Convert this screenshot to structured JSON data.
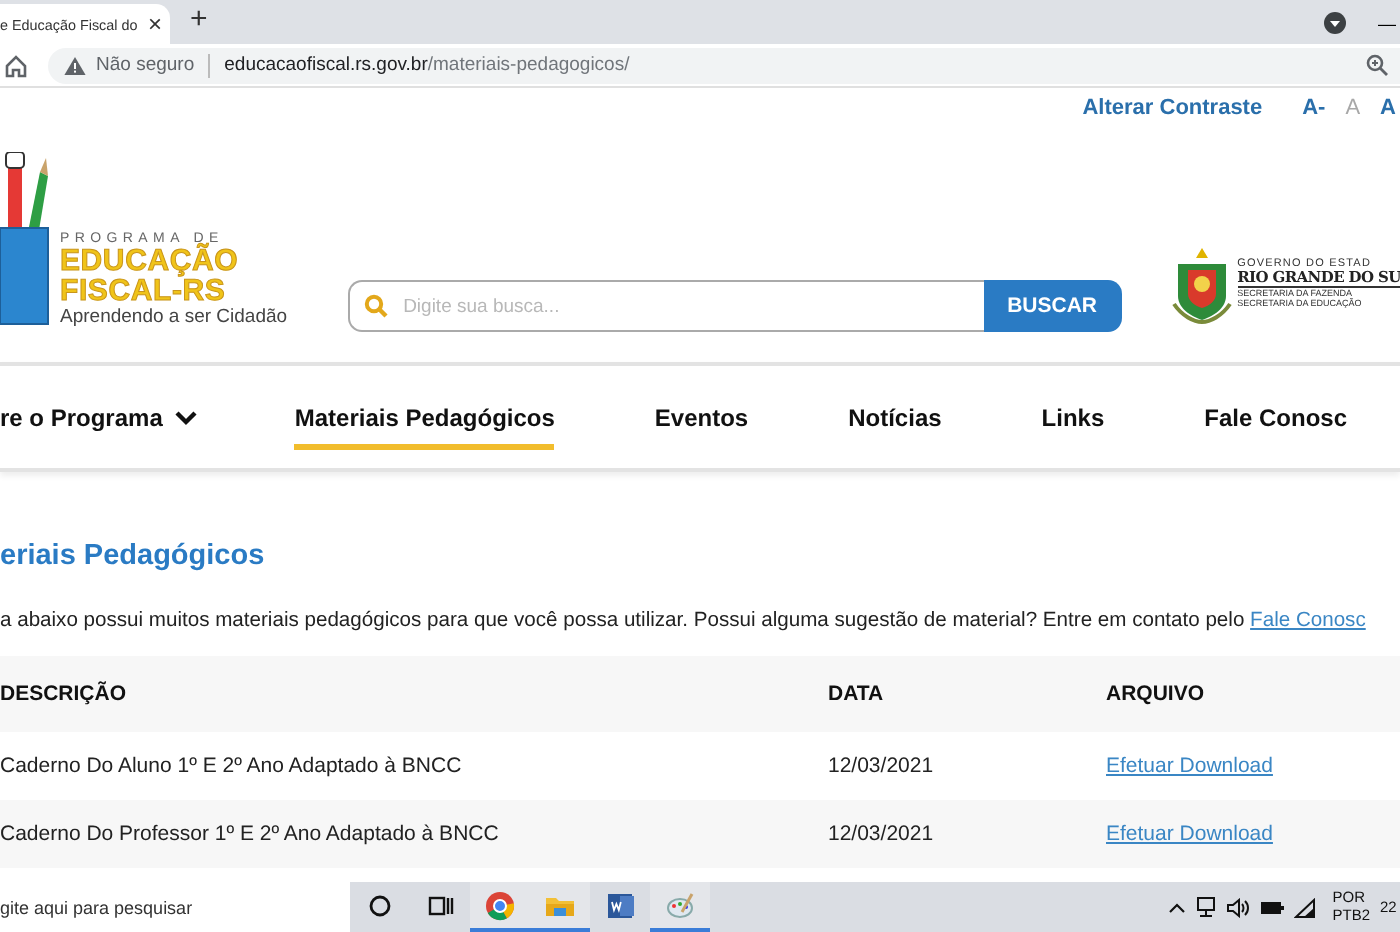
{
  "browser": {
    "tab_title": "e Educação Fiscal do",
    "tab_close": "×",
    "new_tab": "+",
    "minimize": "—",
    "security": "Não seguro",
    "url_host": "educacaofiscal.rs.gov.br",
    "url_path": "/materiais-pedagogicos/"
  },
  "accessibility": {
    "contrast": "Alterar Contraste",
    "font_sizes": [
      {
        "label": "A-",
        "disabled": false
      },
      {
        "label": "A",
        "disabled": true
      },
      {
        "label": "A",
        "disabled": false
      }
    ]
  },
  "logo": {
    "line_1": "PROGRAMA DE",
    "line_2": "EDUCAÇÃO",
    "line_3": "FISCAL-RS",
    "tagline": "Aprendendo a ser Cidadão"
  },
  "search": {
    "placeholder": "Digite sua busca...",
    "button": "BUSCAR"
  },
  "government": {
    "line_1": "GOVERNO DO ESTAD",
    "line_2": "RIO GRANDE DO SU",
    "line_3": "SECRETARIA DA FAZENDA",
    "line_4": "SECRETARIA DA EDUCAÇÃO"
  },
  "nav": [
    {
      "label": "re o Programa",
      "dropdown": true,
      "selected": false
    },
    {
      "label": "Materiais Pedagógicos",
      "dropdown": false,
      "selected": true
    },
    {
      "label": "Eventos",
      "dropdown": false,
      "selected": false
    },
    {
      "label": "Notícias",
      "dropdown": false,
      "selected": false
    },
    {
      "label": "Links",
      "dropdown": false,
      "selected": false
    },
    {
      "label": "Fale Conosc",
      "dropdown": false,
      "selected": false
    }
  ],
  "page": {
    "title": "eriais Pedagógicos",
    "intro": "a abaixo possui muitos materiais pedagógicos para que você possa utilizar. Possui alguma sugestão de material? Entre em contato pelo",
    "intro_link": "Fale Conosc"
  },
  "table": {
    "columns": [
      "DESCRIÇÃO",
      "DATA",
      "ARQUIVO"
    ],
    "rows": [
      {
        "description": "Caderno Do Aluno 1º E 2º Ano Adaptado à BNCC",
        "date": "12/03/2021",
        "file": "Efetuar Download"
      },
      {
        "description": "Caderno Do Professor 1º E 2º Ano Adaptado à BNCC",
        "date": "12/03/2021",
        "file": "Efetuar Download"
      }
    ]
  },
  "taskbar": {
    "search": "gite aqui para pesquisar",
    "apps": [
      {
        "kind": "cortana",
        "active": false
      },
      {
        "kind": "taskview",
        "active": false
      },
      {
        "kind": "chrome",
        "active": true
      },
      {
        "kind": "folder",
        "active": true
      },
      {
        "kind": "word",
        "active": false
      },
      {
        "kind": "paint",
        "active": true
      }
    ],
    "language": "POR",
    "layout": "PTB2",
    "clock": "22"
  }
}
